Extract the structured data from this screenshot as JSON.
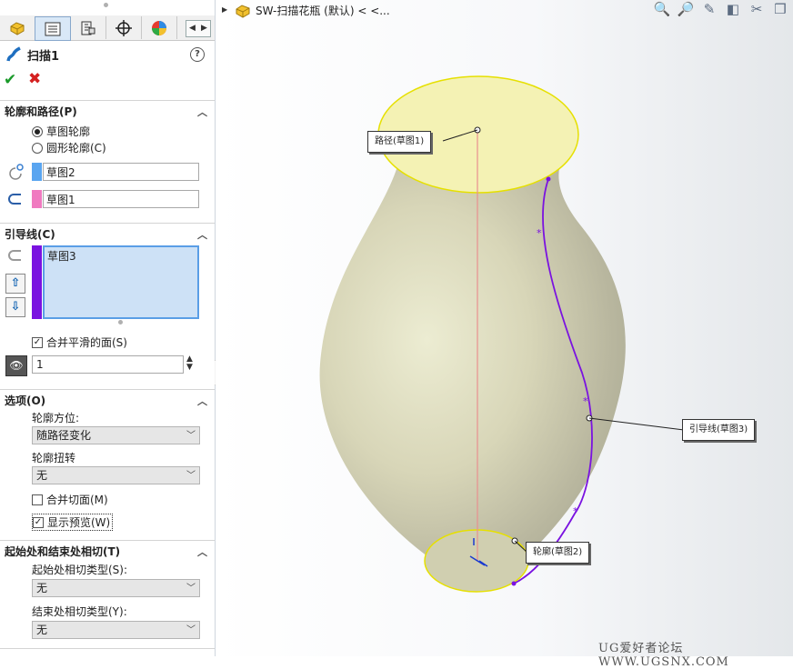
{
  "feature": {
    "title": "扫描1"
  },
  "tabs": [
    {
      "name": "feature-manager-tab-icon"
    },
    {
      "name": "property-manager-tab-icon"
    },
    {
      "name": "configuration-manager-tab-icon"
    },
    {
      "name": "dimxpert-manager-tab-icon"
    },
    {
      "name": "display-manager-tab-icon"
    }
  ],
  "profile_path": {
    "heading": "轮廓和路径(P)",
    "radio_sketch": "草图轮廓",
    "radio_circle": "圆形轮廓(C)",
    "profile_value": "草图2",
    "path_value": "草图1",
    "profile_color": "#5aa5f0",
    "path_color": "#f07ac0"
  },
  "guides": {
    "heading": "引导线(C)",
    "items": [
      "草图3"
    ],
    "guide_color": "#7a12e0",
    "merge_smooth": "合并平滑的面(S)",
    "count_value": "1"
  },
  "options": {
    "heading": "选项(O)",
    "orient_label": "轮廓方位:",
    "orient_value": "随路径变化",
    "twist_label": "轮廓扭转",
    "twist_value": "无",
    "merge_tangent": "合并切面(M)",
    "show_preview": "显示预览(W)"
  },
  "tangency": {
    "heading": "起始处和结束处相切(T)",
    "start_label": "起始处相切类型(S):",
    "start_value": "无",
    "end_label": "结束处相切类型(Y):",
    "end_value": "无"
  },
  "document": {
    "title": "SW-扫描花瓶 (默认) < <..."
  },
  "callouts": {
    "path": "路径(草图1)",
    "guide": "引导线(草图3)",
    "profile": "轮廓(草图2)"
  },
  "watermark": "UG爱好者论坛 WWW.UGSNX.COM"
}
